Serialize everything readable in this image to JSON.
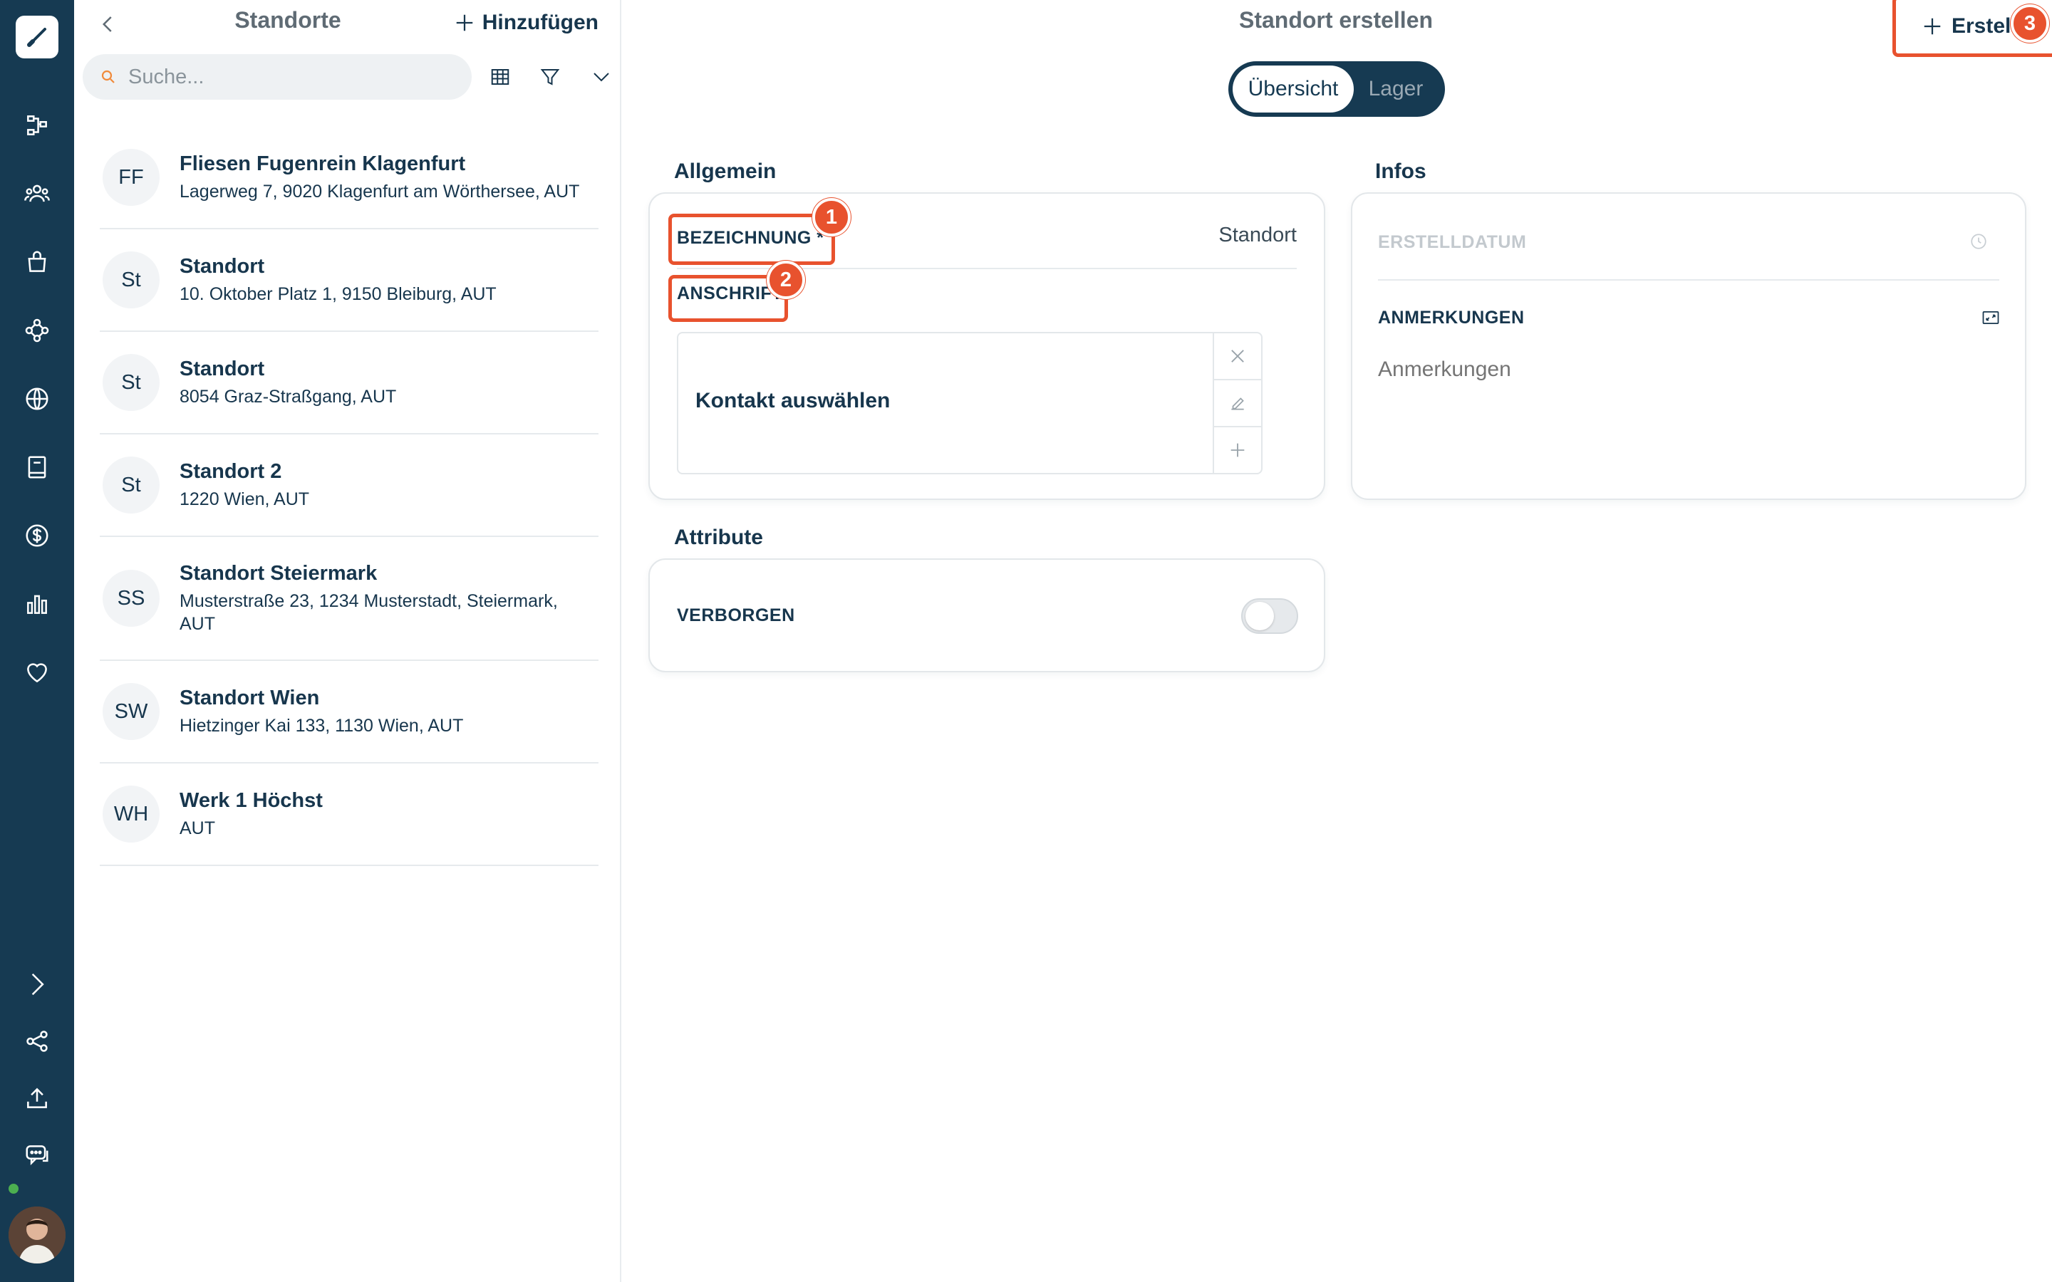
{
  "list_panel": {
    "title": "Standorte",
    "add_label": "Hinzufügen",
    "search_placeholder": "Suche...",
    "items": [
      {
        "initials": "FF",
        "name": "Fliesen Fugenrein Klagenfurt",
        "address": "Lagerweg 7, 9020 Klagenfurt am Wörthersee, AUT"
      },
      {
        "initials": "St",
        "name": "Standort",
        "address": "10. Oktober Platz 1, 9150 Bleiburg, AUT"
      },
      {
        "initials": "St",
        "name": "Standort",
        "address": "8054 Graz-Straßgang, AUT"
      },
      {
        "initials": "St",
        "name": "Standort 2",
        "address": "1220 Wien, AUT"
      },
      {
        "initials": "SS",
        "name": "Standort Steiermark",
        "address": "Musterstraße 23, 1234 Musterstadt, Steiermark, AUT"
      },
      {
        "initials": "SW",
        "name": "Standort Wien",
        "address": "Hietzinger Kai 133, 1130 Wien, AUT"
      },
      {
        "initials": "WH",
        "name": "Werk 1 Höchst",
        "address": "AUT"
      }
    ]
  },
  "main": {
    "title": "Standort erstellen",
    "create_label": "Erstellen",
    "tabs": [
      "Übersicht",
      "Lager"
    ],
    "general": {
      "section": "Allgemein",
      "name_label": "BEZEICHNUNG *",
      "name_value": "Standort",
      "address_label": "ANSCHRIFT",
      "contact_placeholder": "Kontakt auswählen"
    },
    "infos": {
      "section": "Infos",
      "created_label": "ERSTELLDATUM",
      "notes_label": "ANMERKUNGEN",
      "notes_placeholder": "Anmerkungen"
    },
    "attributes": {
      "section": "Attribute",
      "hidden_label": "VERBORGEN",
      "hidden_value": false
    }
  },
  "annotations": [
    "1",
    "2",
    "3"
  ],
  "colors": {
    "sidebar": "#163a52",
    "accent_highlight": "#e8522e",
    "text_primary": "#17364d"
  },
  "rail_icons": [
    "logo-icon",
    "workflow-icon",
    "users-icon",
    "shopping-bag-icon",
    "network-icon",
    "globe-icon",
    "book-icon",
    "dollar-icon",
    "bar-chart-icon",
    "heart-icon",
    "expand-icon",
    "share-icon",
    "upload-icon",
    "chat-icon"
  ]
}
